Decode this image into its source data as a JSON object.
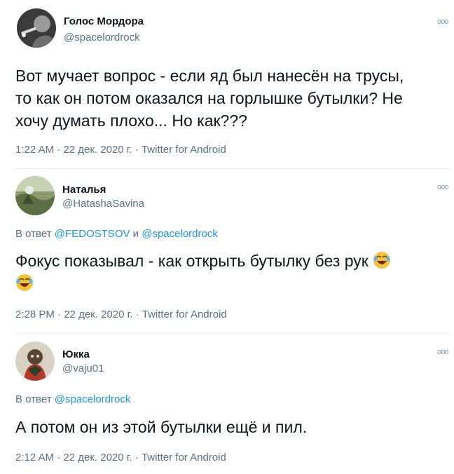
{
  "tweets": [
    {
      "author": "Голос Мордора",
      "handle": "@spacelordrock",
      "more": "ooo",
      "text_lines": [
        "Вот мучает вопрос - если яд был нанесён на трусы,",
        "то как он потом оказался на горлышке бутылки? Не",
        "хочу думать плохо... Но как???"
      ],
      "time": "1:22 AM",
      "date": "22 дек. 2020 г.",
      "source": "Twitter for Android",
      "dot": "·"
    },
    {
      "author": "Наталья",
      "handle": "@HatashaSavina",
      "more": "ooo",
      "reply_prefix": "В ответ",
      "reply_mention_1": "@FEDOSTSOV",
      "reply_and": "и",
      "reply_mention_2": "@spacelordrock",
      "text_line_1": "Фокус показывал - как открыть бутылку без рук",
      "emoji_name": "rolling-on-the-floor-laughing",
      "time": "2:28 PM",
      "date": "22 дек. 2020 г.",
      "source": "Twitter for Android",
      "dot": "·"
    },
    {
      "author": "Юкка",
      "handle": "@vaju01",
      "more": "ooo",
      "reply_prefix": "В ответ",
      "reply_mention_1": "@spacelordrock",
      "text": "А потом он из этой бутылки ещё и пил.",
      "time": "2:12 AM",
      "date": "22 дек. 2020 г.",
      "source": "Twitter for Android",
      "dot": "·"
    }
  ],
  "colors": {
    "text": "#0f1419",
    "secondary": "#5b7083",
    "link": "#1b95e0",
    "divider": "#e6ecf0"
  }
}
